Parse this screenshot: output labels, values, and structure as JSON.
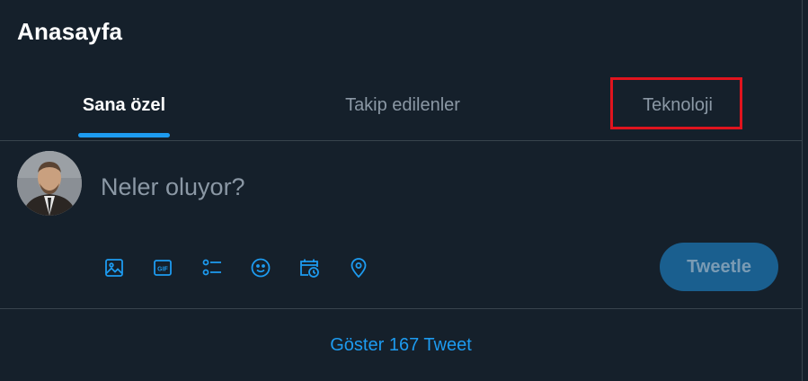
{
  "header": {
    "title": "Anasayfa"
  },
  "tabs": [
    {
      "label": "Sana özel",
      "active": true
    },
    {
      "label": "Takip edilenler",
      "active": false
    },
    {
      "label": "Teknoloji",
      "active": false,
      "highlighted": true
    }
  ],
  "composer": {
    "placeholder": "Neler oluyor?",
    "tools": [
      "image-icon",
      "gif-icon",
      "poll-icon",
      "emoji-icon",
      "schedule-icon",
      "location-icon"
    ],
    "tweet_button": "Tweetle"
  },
  "timeline": {
    "show_more": "Göster 167 Tweet"
  },
  "colors": {
    "background": "#15202b",
    "accent": "#1d9bf0",
    "border": "#38444d",
    "muted_text": "#8b98a5",
    "highlight": "#e0141e"
  }
}
